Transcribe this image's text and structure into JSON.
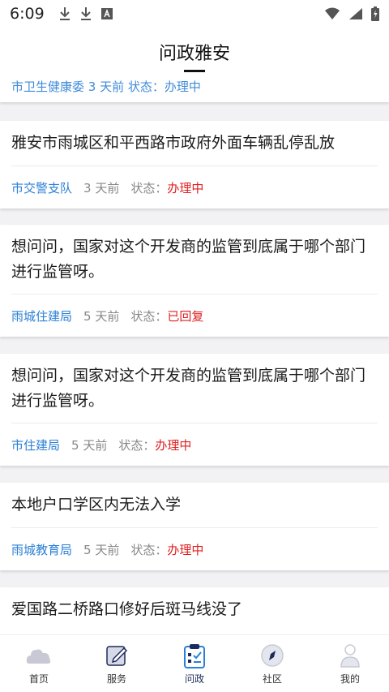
{
  "status_bar": {
    "time": "6:09",
    "icons": [
      "download-icon",
      "download-icon",
      "font-a-icon"
    ],
    "right_icons": [
      "wifi-icon",
      "signal-icon",
      "battery-icon"
    ]
  },
  "header": {
    "title": "问政雅安"
  },
  "partial_top_card": {
    "text": "市卫生健康委  3 天前  状态：办理中"
  },
  "cards": [
    {
      "title": "雅安市雨城区和平西路市政府外面车辆乱停乱放",
      "dept": "市交警支队",
      "time": "3 天前",
      "status_label": "状态：",
      "status": "办理中"
    },
    {
      "title": "想问问，国家对这个开发商的监管到底属于哪个部门进行监管呀。",
      "dept": "雨城住建局",
      "time": "5 天前",
      "status_label": "状态：",
      "status": "已回复"
    },
    {
      "title": "想问问，国家对这个开发商的监管到底属于哪个部门进行监管呀。",
      "dept": "市住建局",
      "time": "5 天前",
      "status_label": "状态：",
      "status": "办理中"
    },
    {
      "title": "本地户口学区内无法入学",
      "dept": "雨城教育局",
      "time": "5 天前",
      "status_label": "状态：",
      "status": "办理中"
    },
    {
      "title": "爱国路二桥路口修好后斑马线没了"
    }
  ],
  "bottom_nav": {
    "items": [
      {
        "label": "首页",
        "icon": "home-cloud-icon"
      },
      {
        "label": "服务",
        "icon": "edit-note-icon"
      },
      {
        "label": "问政",
        "icon": "clipboard-check-icon",
        "active": true
      },
      {
        "label": "社区",
        "icon": "compass-icon"
      },
      {
        "label": "我的",
        "icon": "user-icon"
      }
    ]
  },
  "colors": {
    "dept_blue": "#2b7fd6",
    "status_red": "#e02020",
    "nav_active": "#1d2a5c"
  }
}
